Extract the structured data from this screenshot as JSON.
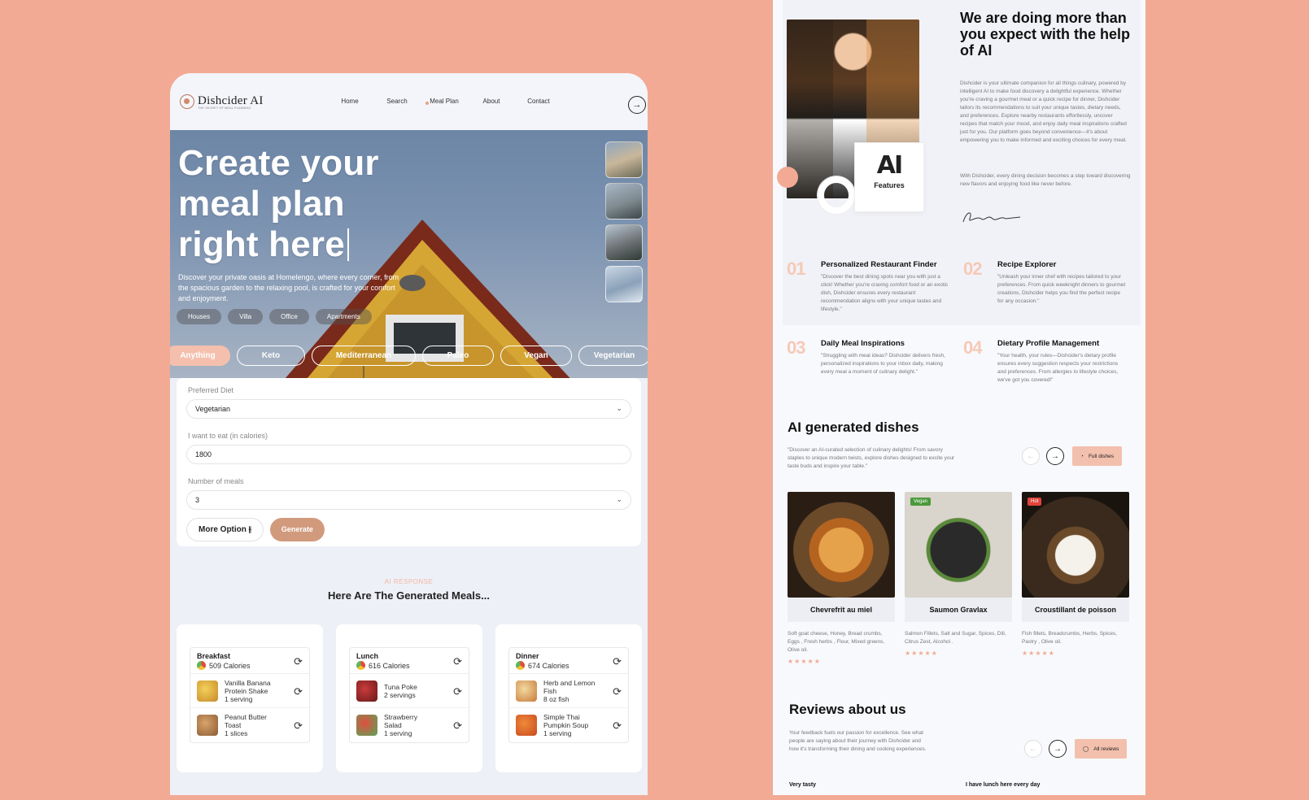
{
  "left": {
    "logo": {
      "name": "Dishcider AI",
      "tagline": "THE SECRET OF MEAL PLANNING"
    },
    "nav": [
      {
        "label": "Home"
      },
      {
        "label": "Search"
      },
      {
        "label": "Meal Plan"
      },
      {
        "label": "About"
      },
      {
        "label": "Contact"
      }
    ],
    "hero": {
      "title_l1": "Create your",
      "title_l2": "meal plan",
      "title_l3": "right here",
      "desc": "Discover your private oasis at Homelengo, where every corner, from the spacious garden to the relaxing pool, is crafted for your comfort and enjoyment.",
      "prop_tabs": [
        "Houses",
        "Villa",
        "Office",
        "Apartments"
      ],
      "diets": [
        "Anything",
        "Keto",
        "Mediterranean",
        "Paleo",
        "Vegan",
        "Vegetarian"
      ]
    },
    "form": {
      "diet_label": "Preferred Diet",
      "diet_value": "Vegetarian",
      "cal_label": "I want to eat (in calories)",
      "cal_value": "1800",
      "meals_label": "Number of meals",
      "meals_value": "3",
      "more_btn": "More Option",
      "gen_btn": "Generate"
    },
    "ai_label": "AI RESPONSE",
    "ai_title": "Here Are The Generated Meals...",
    "meals": [
      {
        "name": "Breakfast",
        "cal": "509 Calories",
        "items": [
          {
            "l1": "Vanilla Banana",
            "l2": "Protein Shake",
            "l3": "1 serving"
          },
          {
            "l1": "Peanut Butter",
            "l2": "Toast",
            "l3": "1 slices"
          }
        ]
      },
      {
        "name": "Lunch",
        "cal": "616 Calories",
        "items": [
          {
            "l1": "Tuna Poke",
            "l2": "2 servings",
            "l3": ""
          },
          {
            "l1": "Strawberry",
            "l2": "Salad",
            "l3": "1 serving"
          }
        ]
      },
      {
        "name": "Dinner",
        "cal": "674 Calories",
        "items": [
          {
            "l1": "Herb and Lemon",
            "l2": "Fish",
            "l3": "8 oz fish"
          },
          {
            "l1": "Simple Thai",
            "l2": "Pumpkin Soup",
            "l3": "1 serving"
          }
        ]
      }
    ]
  },
  "right": {
    "ai_card_logo": "AI",
    "ai_card_label": "Features",
    "heading": "We are doing more than you expect with the help of AI",
    "about_p1": "Dishcider is your ultimate companion for all things culinary, powered by intelligent AI to make food discovery a delightful experience. Whether you're craving a gourmet meal or a quick recipe for dinner, Dishcider tailors its recommendations to suit your unique tastes, dietary needs, and preferences. Explore nearby restaurants effortlessly, uncover recipes that match your mood, and enjoy daily meal inspirations crafted just for you. Our platform goes beyond convenience—it's about empowering you to make informed and exciting choices for every meal.",
    "about_p2": "With Dishcider, every dining decision becomes a step toward discovering new flavors and enjoying food like never before.",
    "features": [
      {
        "num": "01",
        "title": "Personalized Restaurant Finder",
        "desc": "\"Discover the best dining spots near you with just a click! Whether you're craving comfort food or an exotic dish, Dishcider ensures every restaurant recommendation aligns with your unique tastes and lifestyle.\""
      },
      {
        "num": "02",
        "title": "Recipe Explorer",
        "desc": "\"Unleash your inner chef with recipes tailored to your preferences. From quick weeknight dinners to gourmet creations, Dishcider helps you find the perfect recipe for any occasion.\""
      },
      {
        "num": "03",
        "title": "Daily Meal Inspirations",
        "desc": "\"Struggling with meal ideas? Dishcider delivers fresh, personalized inspirations to your inbox daily, making every meal a moment of culinary delight.\""
      },
      {
        "num": "04",
        "title": "Dietary Profile Management",
        "desc": "\"Your health, your rules—Dishcider's dietary profile ensures every suggestion respects your restrictions and preferences. From allergies to lifestyle choices, we've got you covered!\""
      }
    ],
    "dishes_title": "AI generated dishes",
    "dishes_desc": "\"Discover an AI-curated selection of culinary delights! From savory staples to unique modern twists, explore dishes designed to excite your taste buds and inspire your table.\"",
    "full_dishes_btn": "Full dishes",
    "dishes": [
      {
        "name": "Chevrefrit au miel",
        "badge": "",
        "ing": "Soft goat cheese, Honey, Bread crumbs, Eggs , Fresh herbs , Flour, Mixed greens, Olive oil."
      },
      {
        "name": "Saumon Gravlax",
        "badge": "Vegan",
        "ing": "Salmon Fillets, Salt and Sugar, Spices, Dill, Citrus Zest, Alcohol ."
      },
      {
        "name": "Croustillant de poisson",
        "badge": "Hot",
        "ing": "Fish fillets, Breadcrumbs, Herbs, Spices, Pastry , Olive oil."
      }
    ],
    "reviews_title": "Reviews about us",
    "reviews_desc": "Your feedback fuels our passion for excellence. See what people are saying about their journey with Dishcider and how it's transforming their dining and cooking experiences.",
    "all_reviews_btn": "All reviews",
    "review1": "Very tasty",
    "review2": "I have lunch here every day",
    "stars": "★★★★★"
  },
  "colors": {
    "background": "#f2aa94",
    "accent": "#d29a7d",
    "peach": "#f2c0ad"
  }
}
